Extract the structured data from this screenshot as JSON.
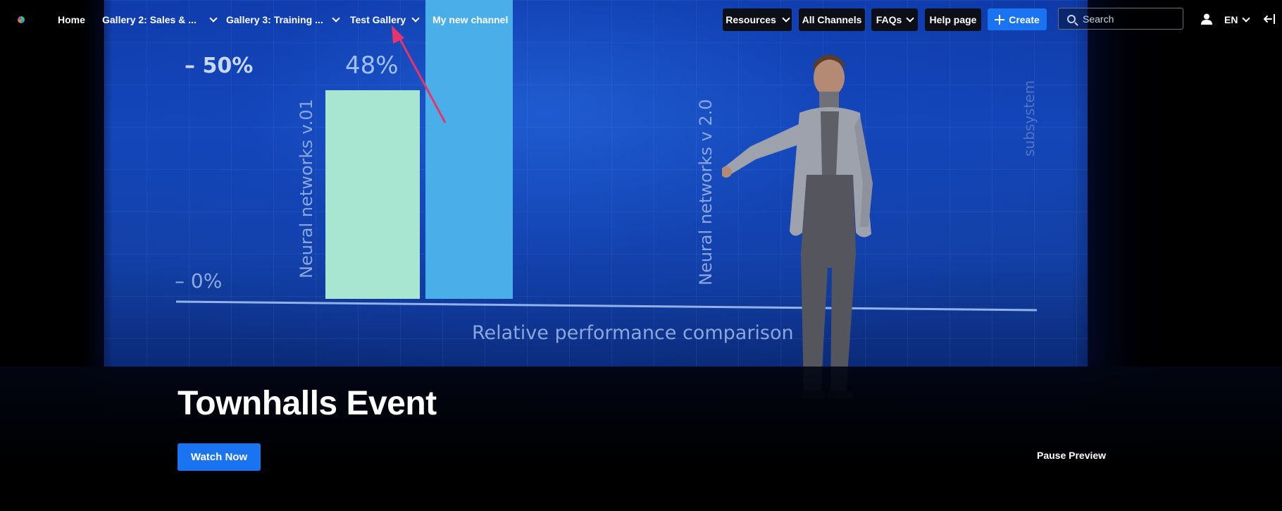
{
  "nav": {
    "home": "Home",
    "gallery2": "Gallery 2: Sales & ...",
    "gallery3": "Gallery 3: Training ...",
    "test_gallery": "Test Gallery",
    "my_channel": "My new channel",
    "resources": "Resources",
    "all_channels": "All Channels",
    "faqs": "FAQs",
    "help_page": "Help page",
    "create": "Create",
    "search_placeholder": "Search",
    "language": "EN"
  },
  "background_slide": {
    "tick_high": "– 50%",
    "tick_low": "– 0%",
    "bar_value_label": "48%",
    "bar1_label": "Neural networks v.01",
    "bar2_label": "Neural networks v 2.0",
    "side_label": "subsystem",
    "axis_caption": "Relative performance comparison"
  },
  "hero": {
    "title": "Townhalls Event",
    "watch_button": "Watch Now",
    "pause_preview": "Pause Preview"
  },
  "colors": {
    "accent": "#1a73f0",
    "annotation_arrow": "#e8336b"
  }
}
